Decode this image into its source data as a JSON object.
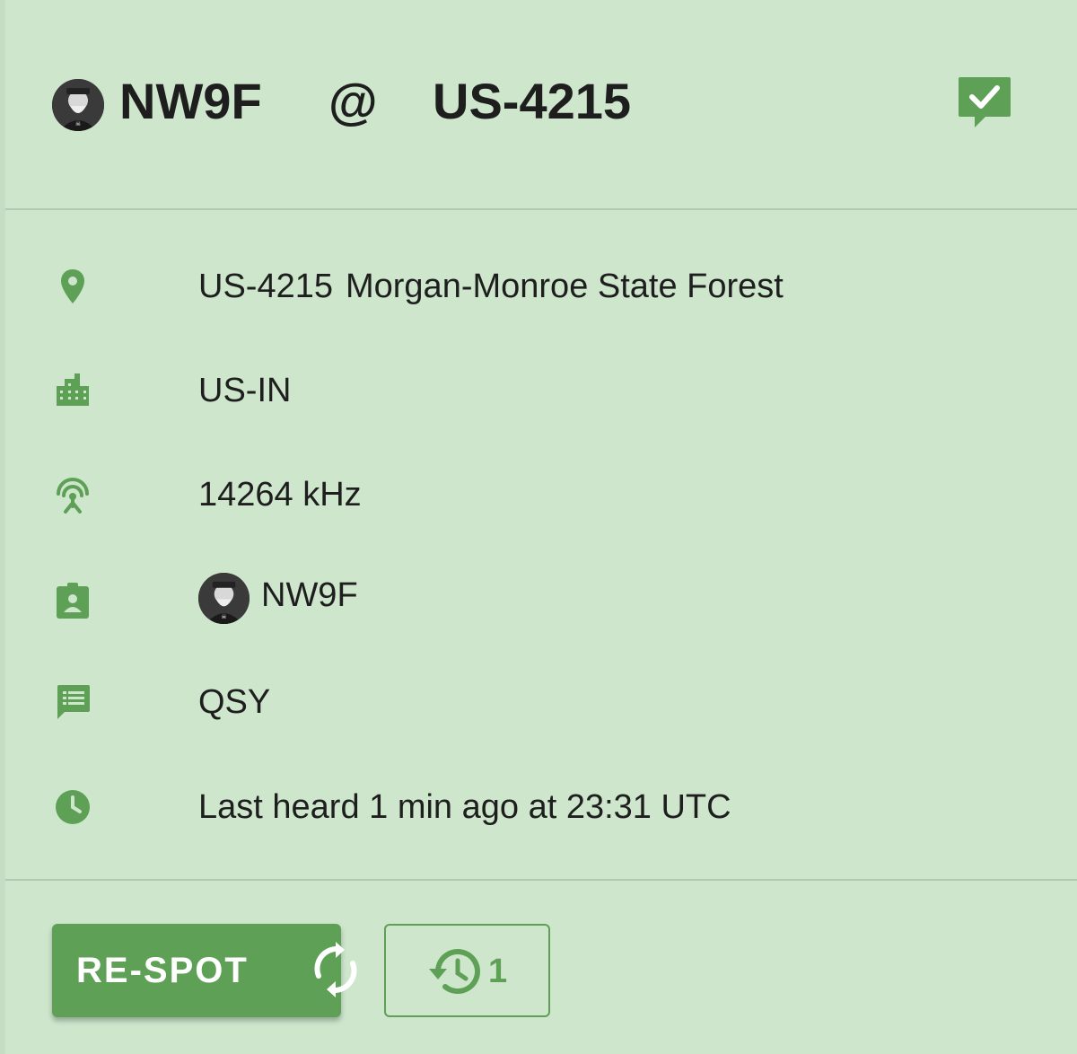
{
  "header": {
    "callsign": "NW9F",
    "at_symbol": "@",
    "reference": "US-4215"
  },
  "details": {
    "park_ref": "US-4215",
    "park_name": "Morgan-Monroe State Forest",
    "location": "US-IN",
    "frequency": "14264 kHz",
    "spotter": "NW9F",
    "comment": "QSY",
    "last_heard": "Last heard 1 min ago at 23:31 UTC"
  },
  "actions": {
    "respot_label": "RE-SPOT",
    "history_count": "1"
  },
  "colors": {
    "background": "#cde6cc",
    "accent": "#5ea055",
    "divider": "#b3c9b2"
  },
  "icons": {
    "header_status": "chat-check-icon",
    "park": "location-pin-icon",
    "location": "city-icon",
    "frequency": "antenna-icon",
    "spotter": "badge-icon",
    "comment": "message-icon",
    "time": "clock-icon",
    "respot": "sync-icon",
    "history": "history-icon"
  }
}
